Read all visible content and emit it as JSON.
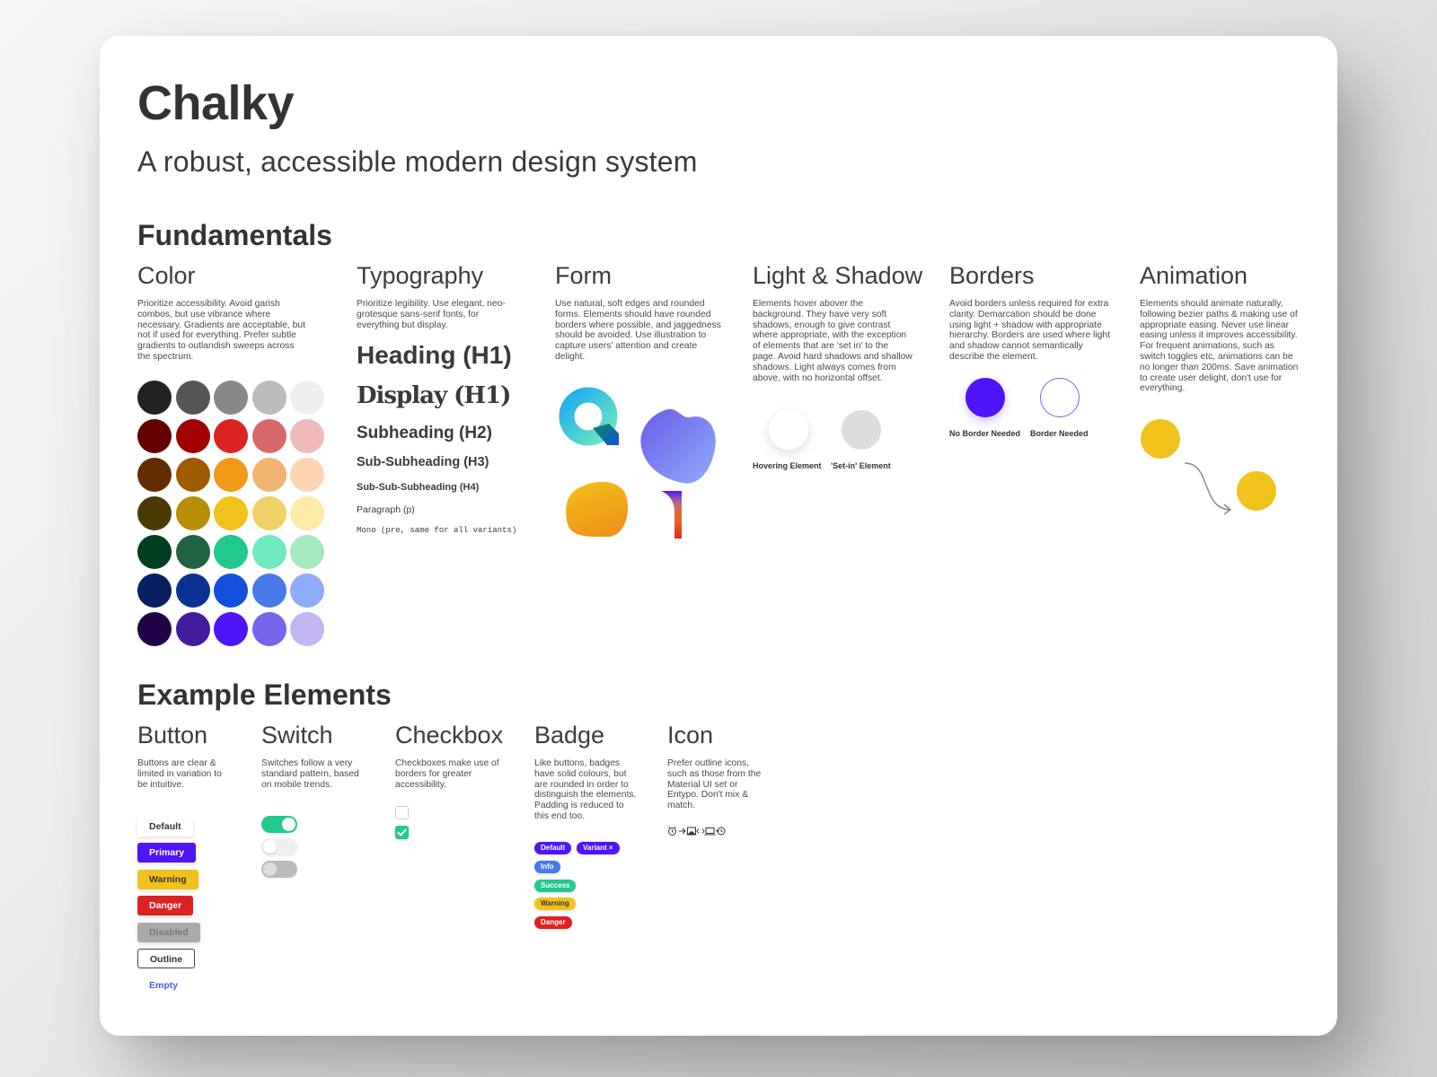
{
  "header": {
    "title": "Chalky",
    "subtitle": "A robust, accessible modern design system"
  },
  "fundamentals": {
    "heading": "Fundamentals",
    "color": {
      "title": "Color",
      "description": "Prioritize accessibility. Avoid garish combos, but use vibrance where necessary. Gradients are acceptable, but not if used for everything. Prefer subtle gradients to outlandish sweeps across the spectrum.",
      "palette": [
        [
          "#222222",
          "#555555",
          "#888888",
          "#bbbbbb",
          "#eeeeee"
        ],
        [
          "#640000",
          "#a00000",
          "#dc2223",
          "#d66a6a",
          "#f0b9b9"
        ],
        [
          "#642d00",
          "#a05a00",
          "#f2991a",
          "#f1b370",
          "#fdd5b2"
        ],
        [
          "#4b3a05",
          "#b78e05",
          "#f2c21c",
          "#f0d167",
          "#fee9a6"
        ],
        [
          "#003f20",
          "#1f6244",
          "#22c98c",
          "#6ee9c0",
          "#a6e9c1"
        ],
        [
          "#081f61",
          "#0a3391",
          "#1450dc",
          "#4679ea",
          "#8eacfa"
        ],
        [
          "#210448",
          "#421c9c",
          "#4f14f8",
          "#7465ec",
          "#c3b5f1"
        ]
      ]
    },
    "typography": {
      "title": "Typography",
      "description": "Prioritize legibility. Use elegant, neo-grotesque sans-serif fonts, for everything but display.",
      "samples": {
        "h1": "Heading (H1)",
        "display": "Display (H1)",
        "h2": "Subheading (H2)",
        "h3": "Sub-Subheading (H3)",
        "h4": "Sub-Sub-Subheading (H4)",
        "p": "Paragraph (p)",
        "mono": "Mono (pre, same for all variants)"
      }
    },
    "form": {
      "title": "Form",
      "description": "Use natural, soft edges and rounded forms. Elements should have rounded borders where possible, and jaggedness should be avoided. Use illustration to capture users' attention and create delight."
    },
    "light_shadow": {
      "title": "Light & Shadow",
      "description": "Elements hover abover the background. They have very soft shadows, enough to give contrast where appropriate, with the exception of elements that are 'set in' to the page. Avoid hard shadows and shallow shadows. Light always comes from above, with no horizontal offset.",
      "examples": [
        "Hovering Element",
        "'Set-in' Element"
      ]
    },
    "borders": {
      "title": "Borders",
      "description": "Avoid borders unless required for extra clarity. Demarcation should be done using light + shadow with appropriate hierarchy. Borders are used where light and shadow cannot semantically describe the element.",
      "examples": [
        "No Border Needed",
        "Border Needed"
      ]
    },
    "animation": {
      "title": "Animation",
      "description": "Elements should animate naturally, following bezier paths & making use of appropriate easing. Never use linear easing unless it improves accessibility. For frequent animations, such as switch toggles etc,  animations can be no longer than 200ms. Save animation to create user delight, don't use for everything."
    }
  },
  "examples": {
    "heading": "Example Elements",
    "button": {
      "title": "Button",
      "description": "Buttons are clear & limited in variation to be intuitive.",
      "buttons": [
        "Default",
        "Primary",
        "Warning",
        "Danger",
        "Disabled",
        "Outline",
        "Empty"
      ]
    },
    "switch": {
      "title": "Switch",
      "description": "Switches follow a very standard pattern, based on mobile trends.",
      "states": [
        "on",
        "off",
        "disabled"
      ]
    },
    "checkbox": {
      "title": "Checkbox",
      "description": "Checkboxes make use of borders for greater accessibility.",
      "states": [
        "unchecked",
        "checked"
      ]
    },
    "badge": {
      "title": "Badge",
      "description": "Like buttons, badges have solid colours, but are rounded in order to distinguish the elements. Padding is reduced to this end too.",
      "badges": [
        "Default",
        "Variant",
        "Info",
        "Success",
        "Warning",
        "Danger"
      ],
      "variant_close": "×"
    },
    "icon": {
      "title": "Icon",
      "description": "Prefer outline icons, such as those from the Material UI set or Entypo. Don't mix & match.",
      "icons": [
        "alarm-icon",
        "arrow-right-icon",
        "image-icon",
        "code-icon",
        "laptop-icon",
        "history-icon"
      ]
    }
  },
  "colors": {
    "primary": "#4f14f8",
    "success": "#22c98c",
    "warning": "#f2c21c",
    "danger": "#dc2223",
    "info": "#4679ea"
  }
}
